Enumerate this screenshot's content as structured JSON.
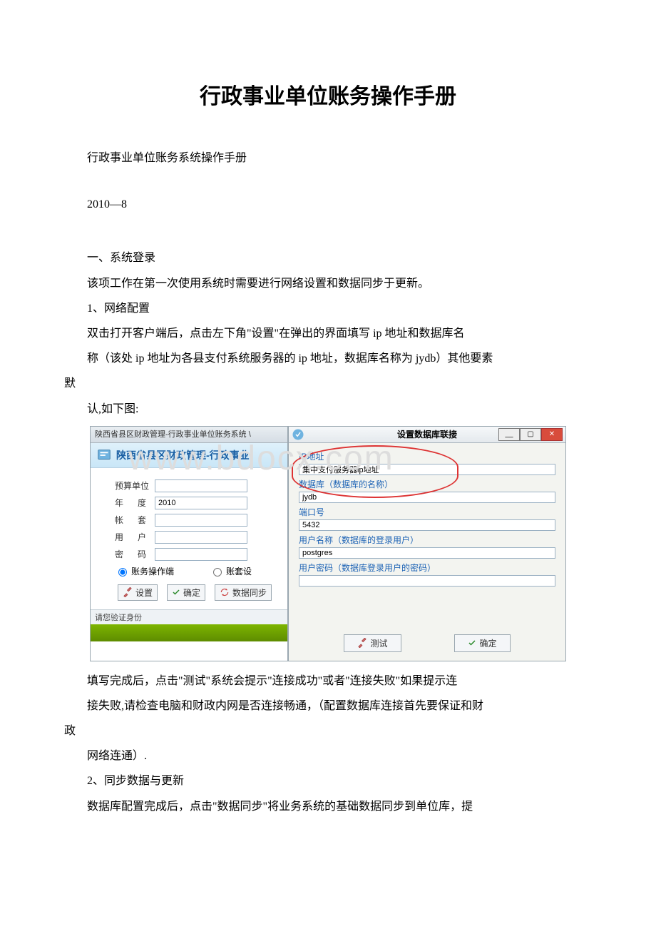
{
  "doc": {
    "title": "行政事业单位账务操作手册",
    "subtitle": "行政事业单位账务系统操作手册",
    "date": "2010—8",
    "section1": "一、系统登录",
    "p1": "该项工作在第一次使用系统时需要进行网络设置和数据同步于更新。",
    "step1": "1、网络配置",
    "p2": "双击打开客户端后，点击左下角\"设置\"在弹出的界面填写 ip 地址和数据库名",
    "p3a": "称（该处 ip 地址为各县支付系统服务器的 ip 地址，数据库名称为 jydb）其他要素",
    "p3b": "默",
    "p4": "认,如下图:",
    "p5": "填写完成后，点击\"测试\"系统会提示\"连接成功\"或者\"连接失败\"如果提示连",
    "p6a": "接失败,请检查电脑和财政内网是否连接畅通，（配置数据库连接首先要保证和财",
    "p6b": "政",
    "p7": "网络连通）.",
    "step2": "2、同步数据与更新",
    "p8": "数据库配置完成后，点击\"数据同步\"将业务系统的基础数据同步到单位库，提"
  },
  "watermark": "www.bdocx.com",
  "login": {
    "tbar": "陕西省县区财政管理-行政事业单位账务系统 \\",
    "header": "陕西省县区财政管理-行政事业!",
    "fields": {
      "unit": "预算单位",
      "year": "年　度",
      "year_val": "2010",
      "set": "帐　套",
      "user": "用　户",
      "pwd": "密　码"
    },
    "radio1": "账务操作端",
    "radio2": "账套设",
    "btn_set": "设置",
    "btn_ok": "确定",
    "btn_sync": "数据同步",
    "status": "请您验证身份"
  },
  "dialog": {
    "title": "设置数据库联接",
    "ip_label": "IP地址",
    "ip_val": "集中支付服务器ip地址",
    "db_label": "数据库（数据库的名称）",
    "db_val": "jydb",
    "port_label": "端口号",
    "port_val": "5432",
    "user_label": "用户名称（数据库的登录用户）",
    "user_val": "postgres",
    "pwd_label": "用户密码（数据库登录用户的密码）",
    "pwd_val": "",
    "btn_test": "测试",
    "btn_ok": "确定"
  }
}
